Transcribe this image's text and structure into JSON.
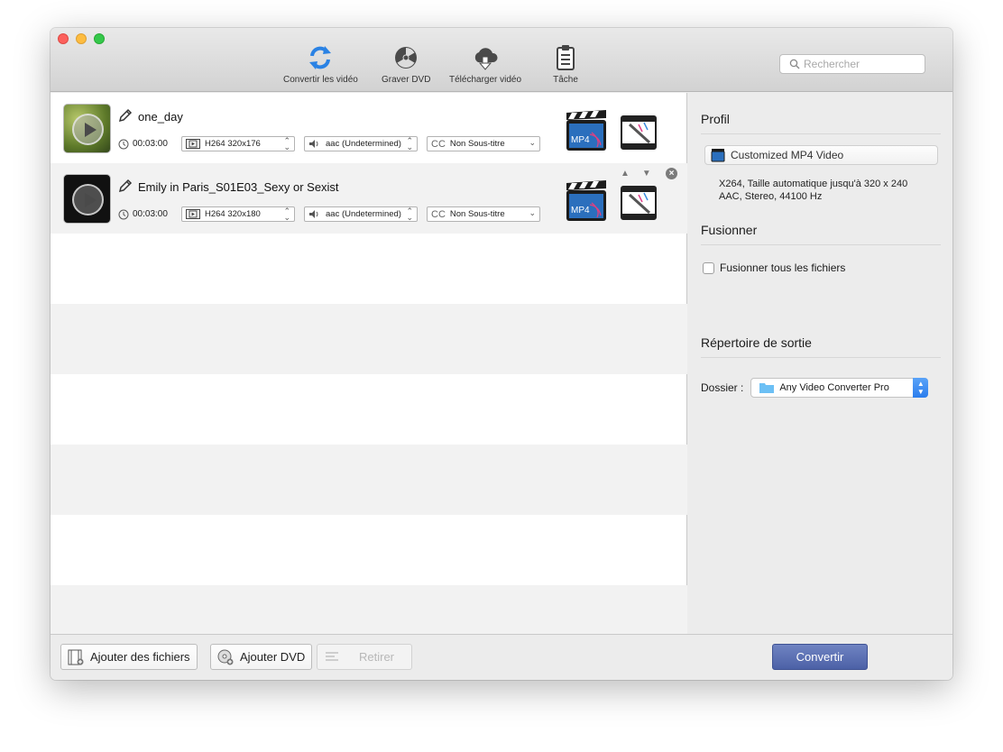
{
  "toolbar": {
    "convert_label": "Convertir les vidéo",
    "burn_label": "Graver DVD",
    "download_label": "Télécharger vidéo",
    "task_label": "Tâche",
    "search_placeholder": "Rechercher"
  },
  "files": [
    {
      "name": "one_day",
      "duration": "00:03:00",
      "video": "H264 320x176",
      "audio": "aac (Undetermined)",
      "subtitle": "Non Sous-titre",
      "cc": "CC"
    },
    {
      "name": "Emily in Paris_S01E03_Sexy or Sexist",
      "duration": "00:03:00",
      "video": "H264 320x180",
      "audio": "aac (Undetermined)",
      "subtitle": "Non Sous-titre",
      "cc": "CC"
    }
  ],
  "format_badge": "MP4",
  "panel": {
    "profile_title": "Profil",
    "profile_value": "Customized MP4 Video",
    "profile_desc_line1": "X264, Taille automatique jusqu'à 320 x 240",
    "profile_desc_line2": "AAC, Stereo, 44100 Hz",
    "merge_title": "Fusionner",
    "merge_checkbox_label": "Fusionner tous les fichiers",
    "merge_checked": false,
    "output_title": "Répertoire de sortie",
    "folder_label": "Dossier :",
    "folder_value": "Any Video Converter Pro"
  },
  "bottom": {
    "add_files_label": "Ajouter des fichiers",
    "add_dvd_label": "Ajouter DVD",
    "remove_label": "Retirer",
    "convert_label": "Convertir"
  },
  "colors": {
    "convert_button": "#5a6eb3",
    "accent_blue": "#2b7ded"
  }
}
